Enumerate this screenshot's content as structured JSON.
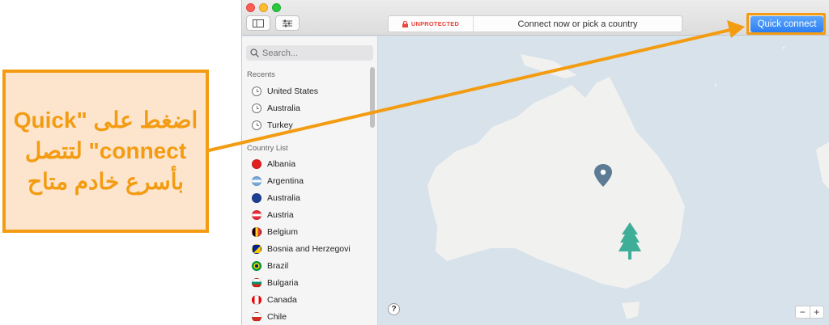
{
  "titlebar": {
    "status_label": "UNPROTECTED",
    "status_message": "Connect now or pick a country",
    "quick_connect_label": "Quick connect"
  },
  "sidebar": {
    "search_placeholder": "Search...",
    "recents_label": "Recents",
    "recents": [
      {
        "label": "United States"
      },
      {
        "label": "Australia"
      },
      {
        "label": "Turkey"
      }
    ],
    "country_list_label": "Country List",
    "countries": [
      {
        "label": "Albania",
        "flag": "albania-flag"
      },
      {
        "label": "Argentina",
        "flag": "argentina-flag"
      },
      {
        "label": "Australia",
        "flag": "australia-flag"
      },
      {
        "label": "Austria",
        "flag": "austria-flag"
      },
      {
        "label": "Belgium",
        "flag": "belgium-flag"
      },
      {
        "label": "Bosnia and Herzegovi",
        "flag": "bosnia-flag"
      },
      {
        "label": "Brazil",
        "flag": "brazil-flag"
      },
      {
        "label": "Bulgaria",
        "flag": "bulgaria-flag"
      },
      {
        "label": "Canada",
        "flag": "canada-flag"
      },
      {
        "label": "Chile",
        "flag": "chile-flag"
      }
    ]
  },
  "map": {
    "help_label": "?",
    "zoom_out_label": "−",
    "zoom_in_label": "+"
  },
  "annotation": {
    "line1": "اضغط على \"Quick",
    "line2": "connect\" لتتصل",
    "line3": "بأسرع خادم متاح"
  },
  "colors": {
    "accent_orange": "#f39c12",
    "callout_bg": "#fde4cc",
    "quick_connect_blue": "#2d7ff2",
    "unprotected_red": "#e8453c",
    "ocean": "#d8e2ea",
    "land": "#f1f1ef",
    "pin": "#5d7b94",
    "tree": "#3fae98"
  }
}
